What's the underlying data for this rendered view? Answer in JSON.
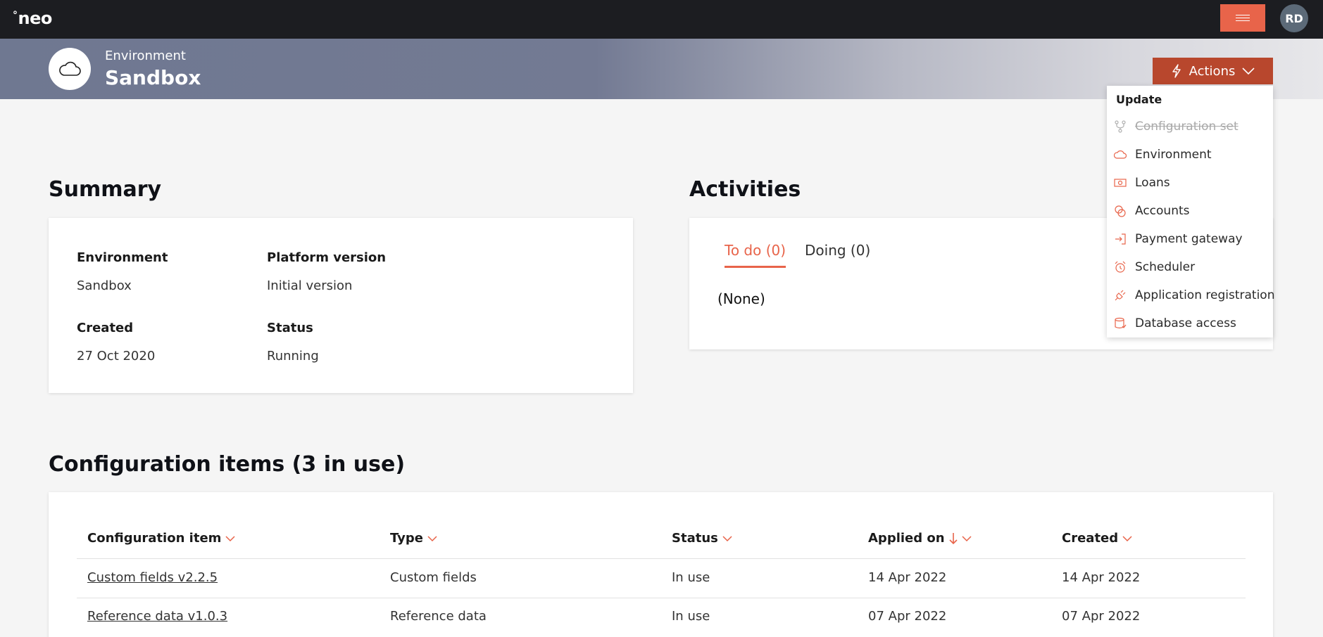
{
  "brand": {
    "logo_text": "neo",
    "logo_mark": "°"
  },
  "topbar": {
    "menu_icon": "hamburger-icon",
    "avatar_initials": "RD",
    "accent": "#e8644a",
    "bg": "#1c1d21"
  },
  "header": {
    "eyebrow": "Environment",
    "title": "Sandbox",
    "icon": "cloud-icon",
    "actions_label": "Actions",
    "actions_color": "#b8472d"
  },
  "actions_menu": {
    "heading": "Update",
    "items": [
      {
        "label": "Configuration set",
        "icon": "branch-icon",
        "disabled": true
      },
      {
        "label": "Environment",
        "icon": "cloud-icon",
        "disabled": false
      },
      {
        "label": "Loans",
        "icon": "money-icon",
        "disabled": false
      },
      {
        "label": "Accounts",
        "icon": "coins-icon",
        "disabled": false
      },
      {
        "label": "Payment gateway",
        "icon": "sign-in-icon",
        "disabled": false
      },
      {
        "label": "Scheduler",
        "icon": "alarm-clock-icon",
        "disabled": false
      },
      {
        "label": "Application registration",
        "icon": "plug-icon",
        "disabled": false
      },
      {
        "label": "Database access",
        "icon": "database-icon",
        "disabled": false
      }
    ]
  },
  "summary": {
    "title": "Summary",
    "environment_label": "Environment",
    "environment_value": "Sandbox",
    "platform_label": "Platform version",
    "platform_value": "Initial version",
    "created_label": "Created",
    "created_value": "27 Oct 2020",
    "status_label": "Status",
    "status_value": "Running"
  },
  "activities": {
    "title": "Activities",
    "tabs": [
      {
        "label": "To do (0)",
        "active": true
      },
      {
        "label": "Doing (0)",
        "active": false
      }
    ],
    "empty_text": "(None)"
  },
  "config_items": {
    "title": "Configuration items (3 in use)",
    "columns": [
      {
        "label": "Configuration item",
        "sort": "none"
      },
      {
        "label": "Type",
        "sort": "none"
      },
      {
        "label": "Status",
        "sort": "none"
      },
      {
        "label": "Applied on",
        "sort": "descending"
      },
      {
        "label": "Created",
        "sort": "none"
      }
    ],
    "rows": [
      {
        "item": "Custom fields v2.2.5",
        "type": "Custom fields",
        "status": "In use",
        "applied_on": "14 Apr 2022",
        "created": "14 Apr 2022"
      },
      {
        "item": "Reference data v1.0.3",
        "type": "Reference data",
        "status": "In use",
        "applied_on": "07 Apr 2022",
        "created": "07 Apr 2022"
      }
    ]
  }
}
